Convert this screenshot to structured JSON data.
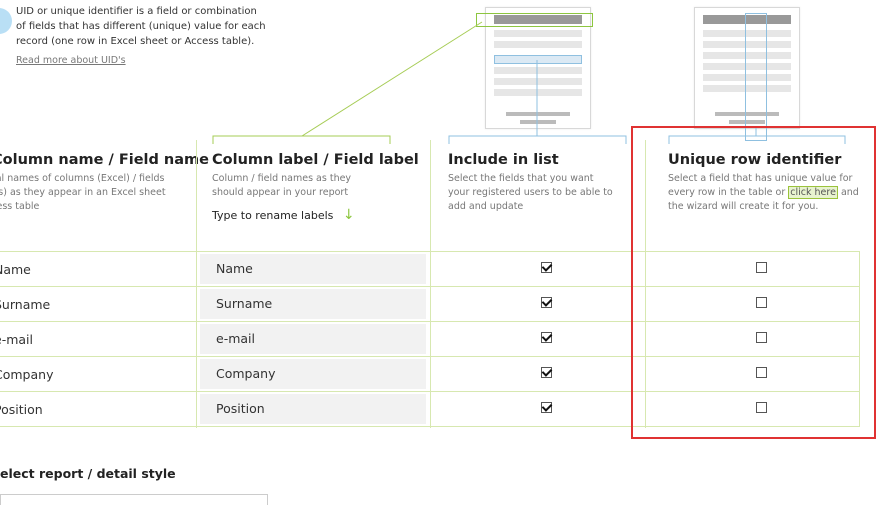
{
  "intro": {
    "text": "UID or unique identifier is a field or combination of fields that has different (unique) value for each record (one row in Excel sheet or Access table).",
    "link": "Read more about UID's"
  },
  "columns": {
    "field_name": {
      "title": "Column name / Field name",
      "desc": "Original names of columns (Excel) / fields (Access) as they appear in an Excel sheet or Access table"
    },
    "label": {
      "title": "Column label / Field label",
      "desc": "Column / field names as they should appear in your report",
      "rename_hint": "Type to rename labels"
    },
    "include": {
      "title": "Include in list",
      "desc": "Select the fields that you want your registered users to be able to add and update"
    },
    "uid": {
      "title": "Unique row identifier",
      "desc_before": "Select a field that has unique value for every row in the table or",
      "link": "click here",
      "desc_after": "and the wizard will create it for you."
    }
  },
  "rows": [
    {
      "field": "Name",
      "label": "Name",
      "include": true,
      "uid": false
    },
    {
      "field": "Surname",
      "label": "Surname",
      "include": true,
      "uid": false
    },
    {
      "field": "e-mail",
      "label": "e-mail",
      "include": true,
      "uid": false
    },
    {
      "field": "Company",
      "label": "Company",
      "include": true,
      "uid": false
    },
    {
      "field": "Position",
      "label": "Position",
      "include": true,
      "uid": false
    }
  ],
  "report_style": {
    "title": "Select report / detail style"
  },
  "icons": {
    "info": "info-icon",
    "arrow": "arrow-down-icon"
  },
  "colors": {
    "accent": "#8dc63f",
    "highlight_border": "#e03232",
    "row_line": "#d7e8b0"
  }
}
